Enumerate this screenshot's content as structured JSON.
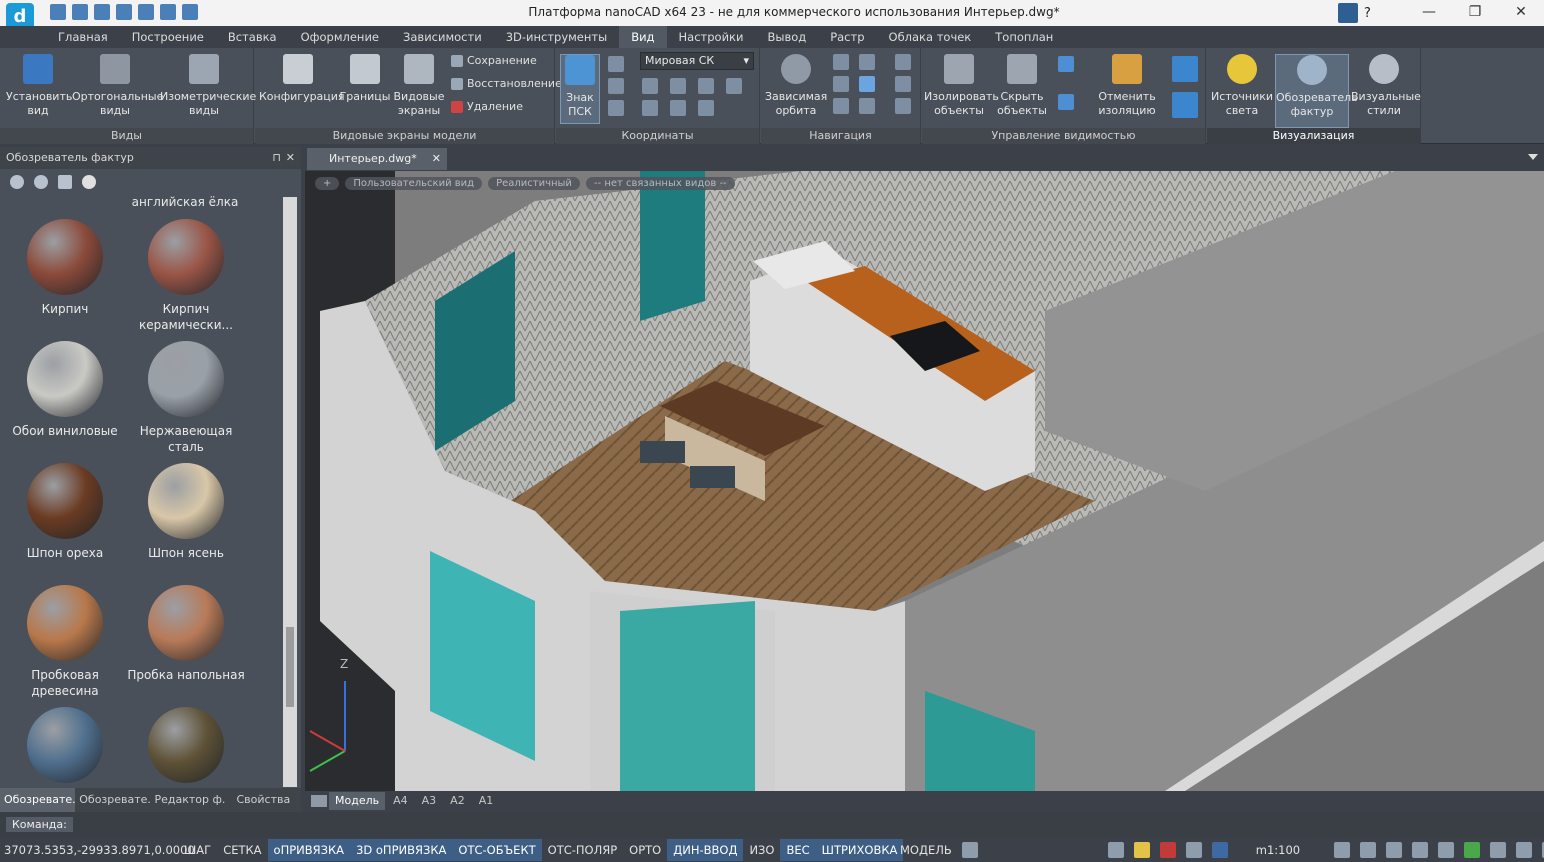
{
  "window": {
    "title": "Платформа nanoCAD x64 23 - не для коммерческого использования Интерьер.dwg*",
    "help_label": "?",
    "minimize": "—",
    "maximize": "❐",
    "close": "✕"
  },
  "menu": {
    "tabs": [
      "Главная",
      "Построение",
      "Вставка",
      "Оформление",
      "Зависимости",
      "3D-инструменты",
      "Вид",
      "Настройки",
      "Вывод",
      "Растр",
      "Облака точек",
      "Топоплан"
    ],
    "active": "Вид"
  },
  "ribbon": {
    "views": {
      "title": "Виды",
      "set_view": "Установить вид",
      "ortho": "Ортогональные виды",
      "iso": "Изометрические виды"
    },
    "viewports": {
      "title": "Видовые экраны модели",
      "config": "Конфигурация",
      "bounds": "Границы",
      "screens": "Видовые экраны",
      "save": "Сохранение",
      "restore": "Восстановление",
      "delete": "Удаление"
    },
    "coords": {
      "title": "Координаты",
      "ucs_icon": "Знак ПСК",
      "world": "Мировая СК"
    },
    "nav": {
      "title": "Навигация",
      "orbit": "Зависимая орбита"
    },
    "visibility": {
      "title": "Управление видимостью",
      "isolate": "Изолировать объекты",
      "hide": "Скрыть объекты",
      "unisolate": "Отменить изоляцию"
    },
    "visual": {
      "title": "Визуализация",
      "lights": "Источники света",
      "textures": "Обозреватель фактур",
      "styles": "Визуальные стили"
    }
  },
  "palette": {
    "title": "Обозреватель фактур",
    "pin": "⊓",
    "close": "✕",
    "top_caption": "английская ёлка",
    "materials": [
      {
        "name": "Кирпич",
        "color": "#8b4a3a"
      },
      {
        "name": "Кирпич керамически...",
        "color": "#9a5546"
      },
      {
        "name": "Обои виниловые",
        "color": "#c9c9c4"
      },
      {
        "name": "Нержавеющая сталь",
        "color": "#9aa0a8"
      },
      {
        "name": "Шпон ореха",
        "color": "#6b3b22"
      },
      {
        "name": "Шпон ясень",
        "color": "#d8c7a8"
      },
      {
        "name": "Пробковая древесина",
        "color": "#b8784a"
      },
      {
        "name": "Пробка напольная",
        "color": "#b87a58"
      },
      {
        "name": "",
        "color": "#4f6f8e"
      },
      {
        "name": "",
        "color": "#5e5236"
      }
    ],
    "tabs": [
      "Обозревате...",
      "Обозревате...",
      "Редактор ф...",
      "Свойства"
    ]
  },
  "document": {
    "tab": "Интерьер.dwg*",
    "tab_close": "✕"
  },
  "viewport": {
    "labels": [
      "+",
      "Пользовательский вид",
      "Реалистичный",
      "-- нет связанных видов --"
    ],
    "axis_z": "Z"
  },
  "layouts": [
    "Модель",
    "A4",
    "A3",
    "A2",
    "A1"
  ],
  "command": {
    "label": "Команда:"
  },
  "status": {
    "coords": "37073.5353,-29933.8971,0.0000",
    "toggles": [
      {
        "label": "ШАГ",
        "on": false
      },
      {
        "label": "СЕТКА",
        "on": false
      },
      {
        "label": "оПРИВЯЗКА",
        "on": true
      },
      {
        "label": "3D оПРИВЯЗКА",
        "on": true
      },
      {
        "label": "ОТС-ОБЪЕКТ",
        "on": true
      },
      {
        "label": "ОТС-ПОЛЯР",
        "on": false
      },
      {
        "label": "ОРТО",
        "on": false
      },
      {
        "label": "ДИН-ВВОД",
        "on": true
      },
      {
        "label": "ИЗО",
        "on": false
      },
      {
        "label": "ВЕС",
        "on": true
      },
      {
        "label": "ШТРИХОВКА",
        "on": true
      }
    ],
    "model": "МОДЕЛЬ",
    "scale": "m1:100"
  }
}
